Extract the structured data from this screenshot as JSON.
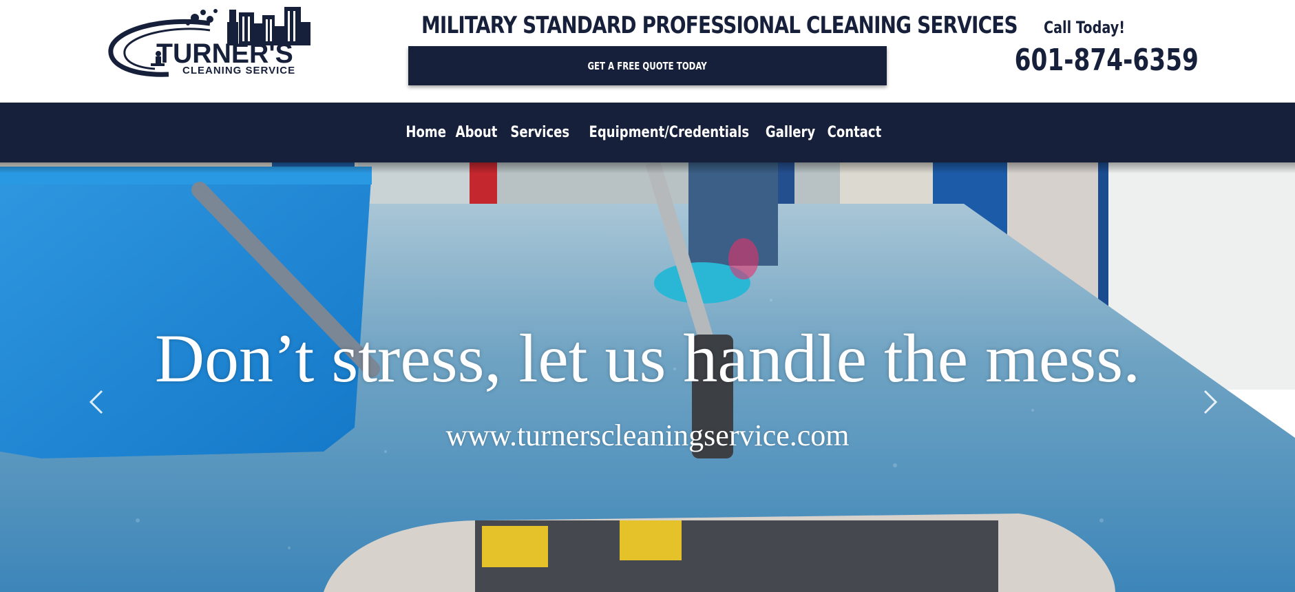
{
  "header": {
    "logo": {
      "brand": "TURNER'S",
      "subtitle": "CLEANING SERVICE"
    },
    "tagline": "MILITARY STANDARD PROFESSIONAL CLEANING SERVICES",
    "quote_button": "GET A FREE QUOTE TODAY",
    "call_label": "Call Today!",
    "phone": "601-874-6359"
  },
  "nav": {
    "items": [
      {
        "label": "Home"
      },
      {
        "label": "About"
      },
      {
        "label": "Services"
      },
      {
        "label": "Equipment/Credentials"
      },
      {
        "label": "Gallery"
      },
      {
        "label": "Contact"
      }
    ]
  },
  "hero": {
    "headline": "Don’t stress, let us handle the mess.",
    "url": "www.turnerscleaningservice.com",
    "prev_icon": "chevron-left-icon",
    "next_icon": "chevron-right-icon"
  },
  "colors": {
    "brand_navy": "#17203a",
    "white": "#ffffff"
  }
}
